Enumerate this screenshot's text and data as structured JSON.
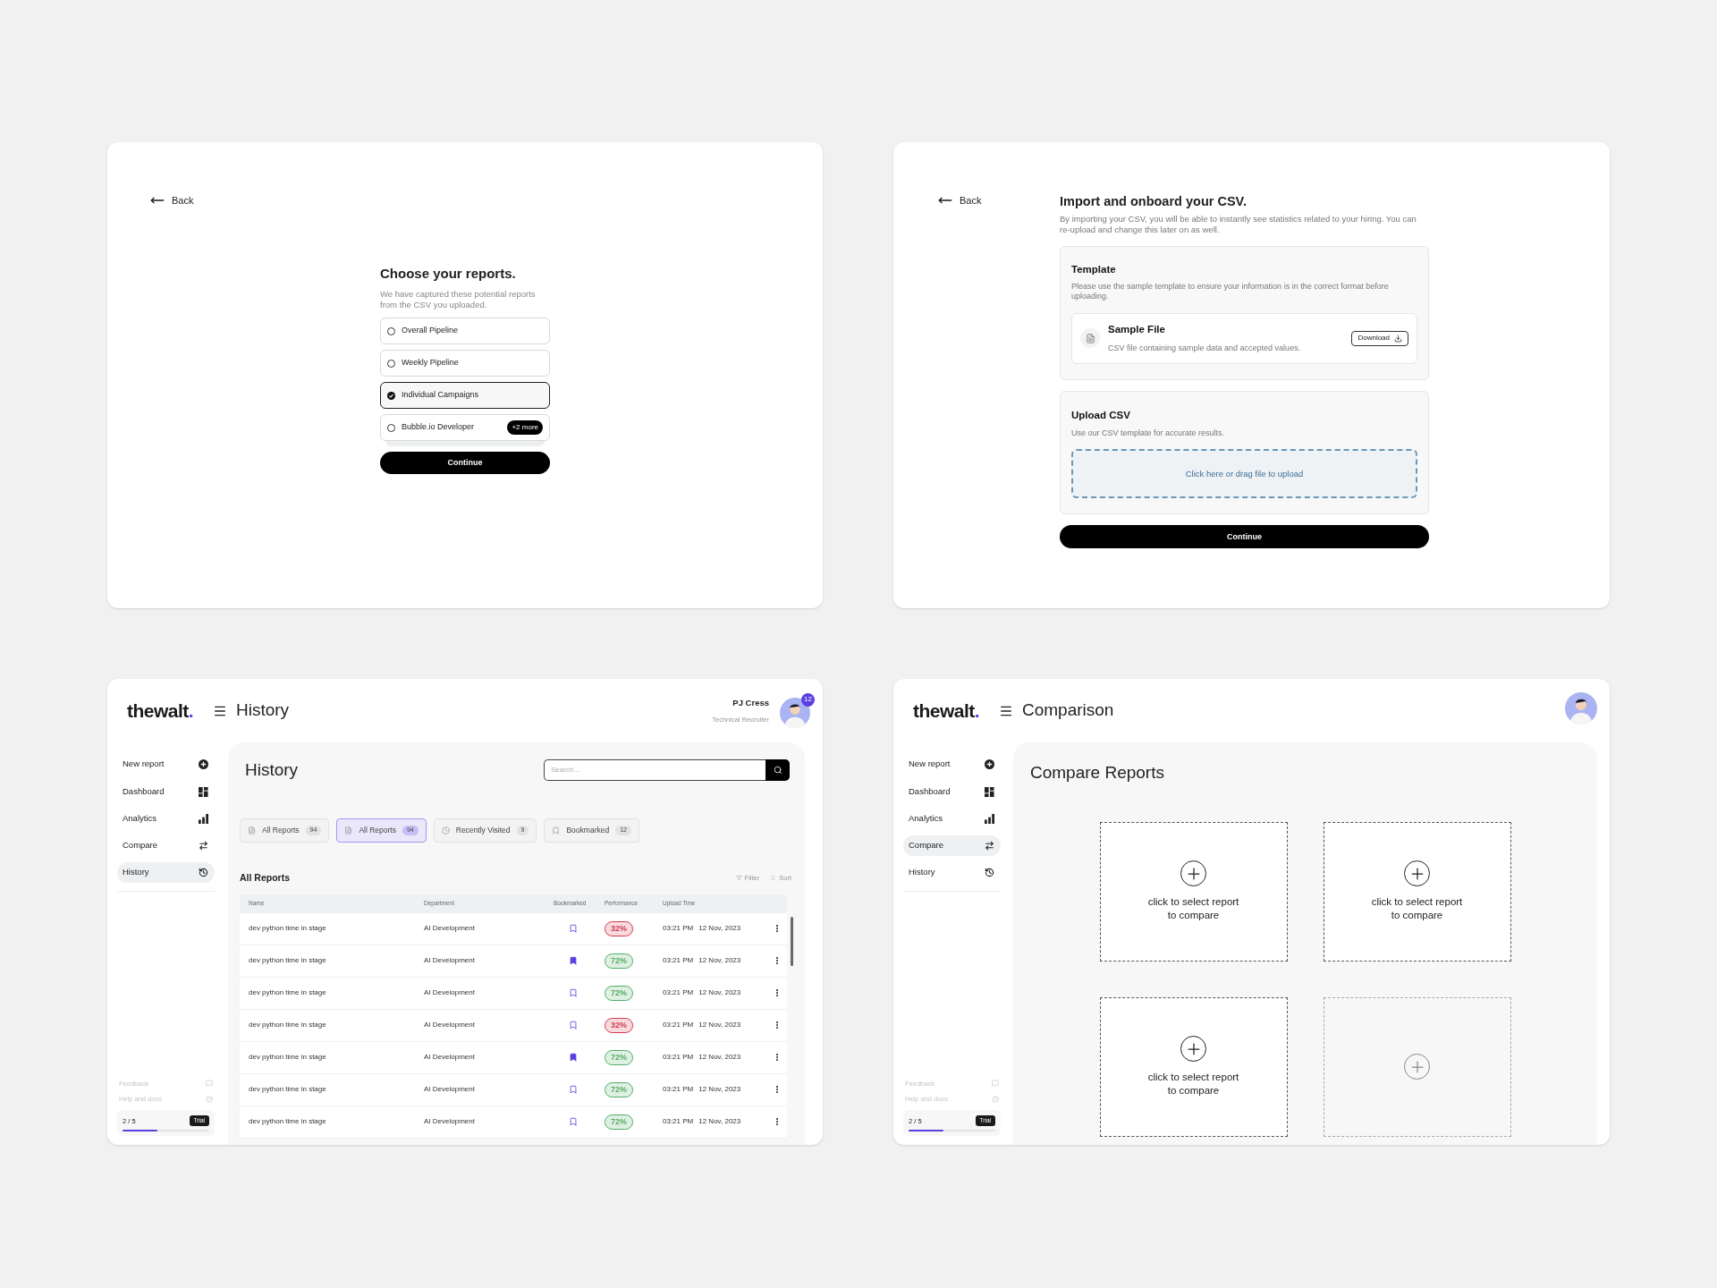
{
  "choose_reports": {
    "back": "Back",
    "title": "Choose your reports.",
    "subtitle": "We have captured these potential reports from the CSV you uploaded.",
    "options": [
      {
        "label": "Overall Pipeline",
        "selected": false
      },
      {
        "label": "Weekly Pipeline",
        "selected": false
      },
      {
        "label": "Individual Campaigns",
        "selected": true
      },
      {
        "label": "Bubble.io Developer",
        "selected": false,
        "badge": "+2 more"
      }
    ],
    "continue": "Continue"
  },
  "import_csv": {
    "back": "Back",
    "title": "Import and onboard your CSV.",
    "subtitle": "By importing your CSV, you will be able to instantly see statistics related to your hiring. You can re-upload and change this later on as well.",
    "template": {
      "title": "Template",
      "description": "Please use the sample template to ensure your information is in the correct format before uploading.",
      "file": {
        "name": "Sample File",
        "description": "CSV file containing sample data and accepted values.",
        "button": "Download"
      }
    },
    "upload": {
      "title": "Upload CSV",
      "description": "Use our CSV template for accurate results.",
      "dropzone": "Click here or drag file to upload"
    },
    "continue": "Continue"
  },
  "history_screen": {
    "logo": {
      "name": "thewalt",
      "dot": "."
    },
    "page_title": "History",
    "user": {
      "name": "PJ Cress",
      "role": "Technical Recruiter",
      "notifications": "12"
    },
    "sidebar": {
      "items": [
        {
          "label": "New report",
          "selected": false
        },
        {
          "label": "Dashboard",
          "selected": false
        },
        {
          "label": "Analytics",
          "selected": false
        },
        {
          "label": "Compare",
          "selected": false
        },
        {
          "label": "History",
          "selected": true
        }
      ],
      "footer": [
        {
          "label": "Feedback"
        },
        {
          "label": "Help and docs"
        }
      ],
      "usage": {
        "text": "2 / 5",
        "badge": "Trial",
        "level": 0.4
      }
    },
    "heading": "History",
    "search": {
      "placeholder": "Search..."
    },
    "tabs": [
      {
        "label": "All Reports",
        "count": "94",
        "selected": false
      },
      {
        "label": "All Reports",
        "count": "94",
        "selected": true
      },
      {
        "label": "Recently Visited",
        "count": "9",
        "selected": false
      },
      {
        "label": "Bookmarked",
        "count": "12",
        "selected": false
      }
    ],
    "section_title": "All Reports",
    "filter": "Filter",
    "sort": "Sort",
    "table": {
      "columns": [
        "Name",
        "Department",
        "Bookmarked",
        "Performance",
        "Upload Time"
      ],
      "rows": [
        {
          "name": "dev python time in stage",
          "department": "AI Development",
          "bookmarked": false,
          "performance": "32%",
          "color": "#d33a4e",
          "time": "03:21 PM",
          "date": "12 Nov, 2023"
        },
        {
          "name": "dev python time in stage",
          "department": "AI Development",
          "bookmarked": true,
          "performance": "72%",
          "color": "#4fae65",
          "time": "03:21 PM",
          "date": "12 Nov, 2023"
        },
        {
          "name": "dev python time in stage",
          "department": "AI Development",
          "bookmarked": false,
          "performance": "72%",
          "color": "#4fae65",
          "time": "03:21 PM",
          "date": "12 Nov, 2023"
        },
        {
          "name": "dev python time in stage",
          "department": "AI Development",
          "bookmarked": false,
          "performance": "32%",
          "color": "#d33a4e",
          "time": "03:21 PM",
          "date": "12 Nov, 2023"
        },
        {
          "name": "dev python time in stage",
          "department": "AI Development",
          "bookmarked": true,
          "performance": "72%",
          "color": "#4fae65",
          "time": "03:21 PM",
          "date": "12 Nov, 2023"
        },
        {
          "name": "dev python time in stage",
          "department": "AI Development",
          "bookmarked": false,
          "performance": "72%",
          "color": "#4fae65",
          "time": "03:21 PM",
          "date": "12 Nov, 2023"
        },
        {
          "name": "dev python time in stage",
          "department": "AI Development",
          "bookmarked": false,
          "performance": "72%",
          "color": "#4fae65",
          "time": "03:21 PM",
          "date": "12 Nov, 2023"
        }
      ]
    }
  },
  "comparison_screen": {
    "logo": {
      "name": "thewalt",
      "dot": "."
    },
    "page_title": "Comparison",
    "sidebar": {
      "items": [
        {
          "label": "New report",
          "selected": false
        },
        {
          "label": "Dashboard",
          "selected": false
        },
        {
          "label": "Analytics",
          "selected": false
        },
        {
          "label": "Compare",
          "selected": true
        },
        {
          "label": "History",
          "selected": false
        }
      ],
      "footer": [
        {
          "label": "Feedback"
        },
        {
          "label": "Help and docs"
        }
      ],
      "usage": {
        "text": "2 / 5",
        "badge": "Trial",
        "level": 0.4
      }
    },
    "heading": "Compare Reports",
    "slots": [
      {
        "label": "click to select report to compare",
        "disabled": false
      },
      {
        "label": "click to select report to compare",
        "disabled": false
      },
      {
        "label": "click to select report to compare",
        "disabled": false
      },
      {
        "disabled": true
      }
    ]
  }
}
